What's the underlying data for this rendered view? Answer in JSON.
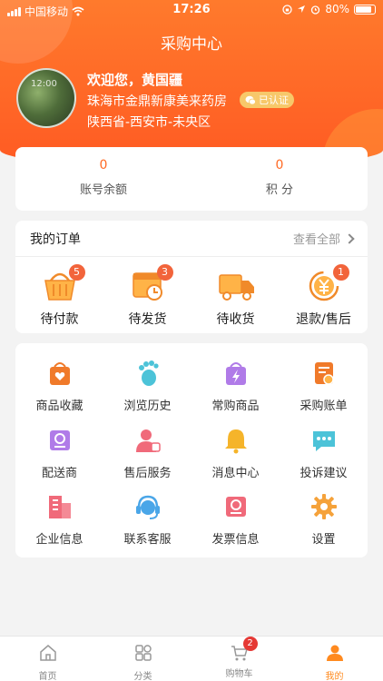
{
  "status_bar": {
    "carrier": "中国移动",
    "time": "17:26",
    "battery": "80%"
  },
  "header": {
    "title": "采购中心"
  },
  "profile": {
    "welcome": "欢迎您，黄国疆",
    "shop": "珠海市金鼎新康美来药房",
    "verified": "已认证",
    "region": "陕西省-西安市-未央区",
    "avatar_text": "12:00"
  },
  "balance": [
    {
      "value": "0",
      "label": "账号余额"
    },
    {
      "value": "0",
      "label": "积 分"
    }
  ],
  "orders": {
    "title": "我的订单",
    "view_all": "查看全部",
    "items": [
      {
        "label": "待付款",
        "badge": "5",
        "icon": "basket-icon"
      },
      {
        "label": "待发货",
        "badge": "3",
        "icon": "box-clock-icon"
      },
      {
        "label": "待收货",
        "badge": "",
        "icon": "truck-icon"
      },
      {
        "label": "退款/售后",
        "badge": "1",
        "icon": "yen-refund-icon"
      }
    ]
  },
  "tools": [
    {
      "label": "商品收藏",
      "icon": "favorite-bag-icon",
      "color": "#f07a2a"
    },
    {
      "label": "浏览历史",
      "icon": "footprint-icon",
      "color": "#4cc3d8"
    },
    {
      "label": "常购商品",
      "icon": "lightning-bag-icon",
      "color": "#b07be8"
    },
    {
      "label": "采购账单",
      "icon": "bill-icon",
      "color": "#f07a2a"
    },
    {
      "label": "配送商",
      "icon": "distributor-icon",
      "color": "#b07be8"
    },
    {
      "label": "售后服务",
      "icon": "after-sales-icon",
      "color": "#f06a7a"
    },
    {
      "label": "消息中心",
      "icon": "bell-icon",
      "color": "#f5b42a"
    },
    {
      "label": "投诉建议",
      "icon": "chat-icon",
      "color": "#4cc3d8"
    },
    {
      "label": "企业信息",
      "icon": "building-icon",
      "color": "#f06a7a"
    },
    {
      "label": "联系客服",
      "icon": "headset-icon",
      "color": "#4aa6e8"
    },
    {
      "label": "发票信息",
      "icon": "invoice-icon",
      "color": "#f06a7a"
    },
    {
      "label": "设置",
      "icon": "gear-icon",
      "color": "#f5a23a"
    }
  ],
  "tabbar": [
    {
      "label": "首页",
      "icon": "home-icon"
    },
    {
      "label": "分类",
      "icon": "grid-icon"
    },
    {
      "label": "购物车",
      "icon": "cart-icon",
      "badge": "2"
    },
    {
      "label": "我的",
      "icon": "user-icon"
    }
  ]
}
